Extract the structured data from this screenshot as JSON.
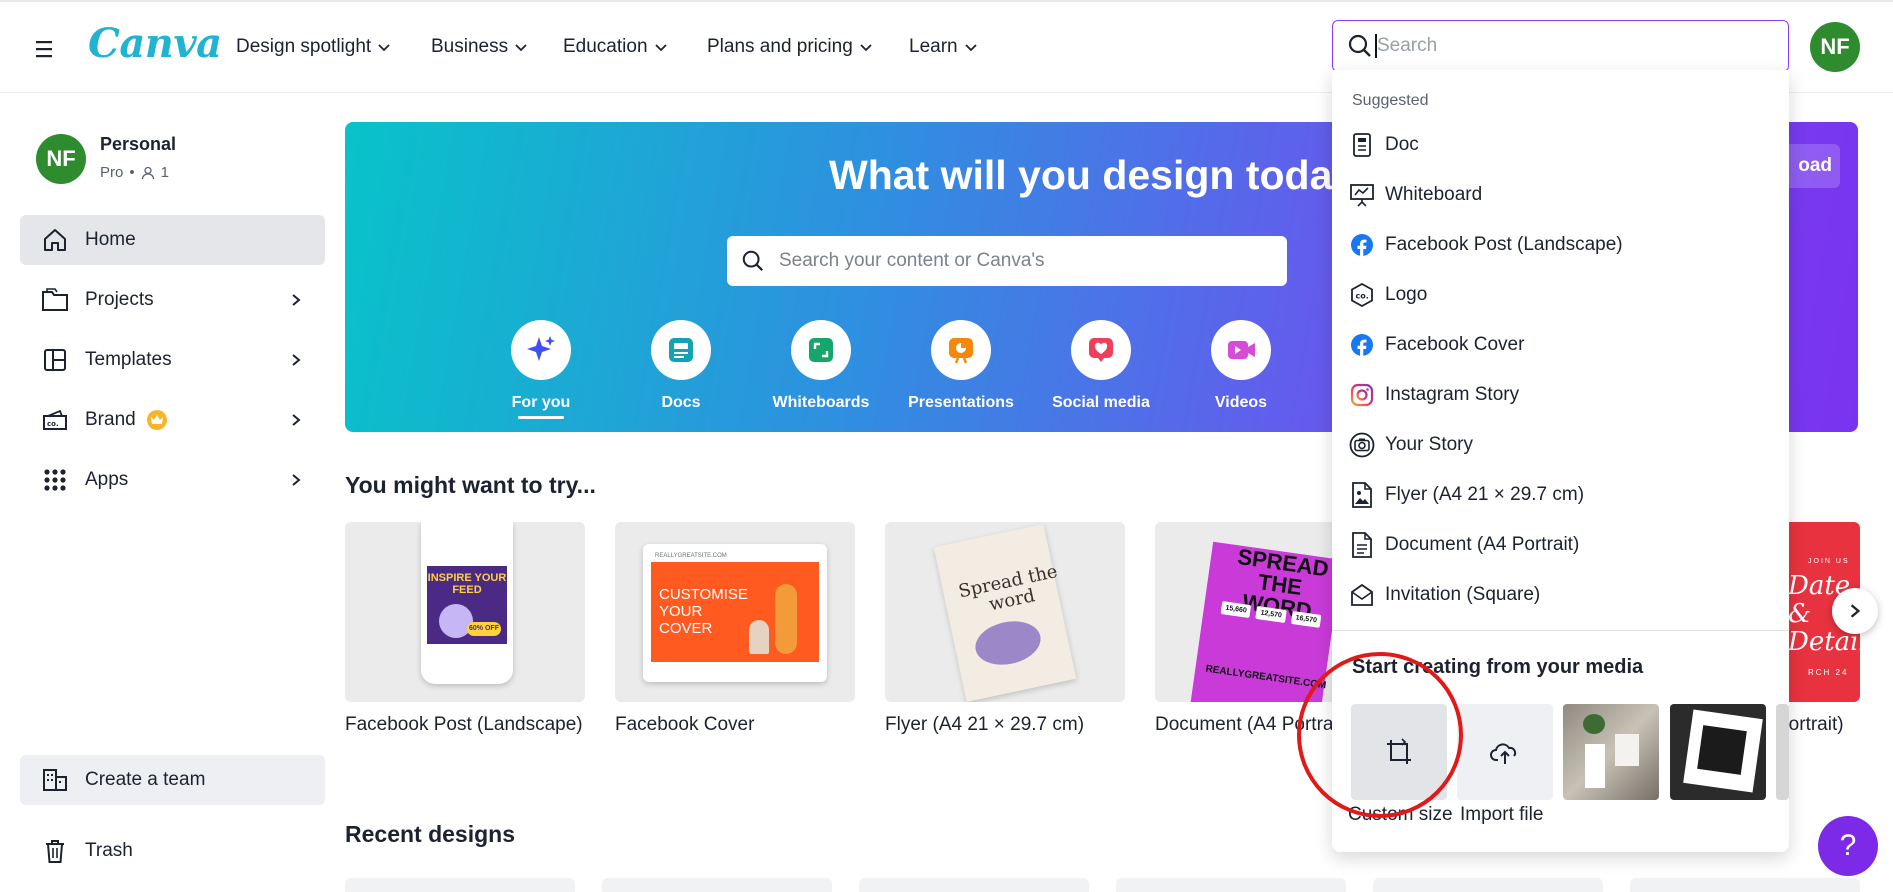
{
  "header": {
    "logo": "Canva",
    "nav": [
      {
        "label": "Design spotlight"
      },
      {
        "label": "Business"
      },
      {
        "label": "Education"
      },
      {
        "label": "Plans and pricing"
      },
      {
        "label": "Learn"
      }
    ],
    "search_placeholder": "Search",
    "avatar_initials": "NF"
  },
  "sidebar": {
    "account_name": "Personal",
    "account_plan": "Pro",
    "account_members": "1",
    "avatar_initials": "NF",
    "items": [
      {
        "label": "Home",
        "icon": "home-icon",
        "active": true
      },
      {
        "label": "Projects",
        "icon": "folder-icon"
      },
      {
        "label": "Templates",
        "icon": "templates-icon"
      },
      {
        "label": "Brand",
        "icon": "brand-icon"
      },
      {
        "label": "Apps",
        "icon": "apps-grid-icon"
      }
    ],
    "create_team": "Create a team",
    "trash": "Trash"
  },
  "hero": {
    "title": "What will you design toda",
    "search_placeholder": "Search your content or Canva's",
    "upload_label": "oad",
    "categories": [
      {
        "label": "For you",
        "icon": "sparkle-icon",
        "color": "#3f4ff2"
      },
      {
        "label": "Docs",
        "icon": "docs-icon",
        "color": "#13a3b5"
      },
      {
        "label": "Whiteboards",
        "icon": "whiteboard-icon",
        "color": "#15a66b"
      },
      {
        "label": "Presentations",
        "icon": "presentation-icon",
        "color": "#f2890b"
      },
      {
        "label": "Social media",
        "icon": "heart-icon",
        "color": "#ef3e5c"
      },
      {
        "label": "Videos",
        "icon": "video-icon",
        "color": "#d84ad8"
      }
    ]
  },
  "try_section": {
    "title": "You might want to try...",
    "cards": [
      {
        "label": "Facebook Post (Landscape)",
        "thumb_text": "INSPIRE YOUR FEED",
        "badge": "60% OFF"
      },
      {
        "label": "Facebook Cover",
        "thumb_text": "CUSTOMISE YOUR COVER",
        "site": "REALLYGREATSITE.COM"
      },
      {
        "label": "Flyer (A4 21 × 29.7 cm)",
        "thumb_text": "Spread the word"
      },
      {
        "label": "Document (A4 Portra",
        "thumb_text": "SPREAD THE WORD",
        "stats": [
          "15,660",
          "12,570",
          "16,570"
        ],
        "site": "REALLYGREATSITE.COM"
      },
      {
        "label": "Portrait)",
        "thumb_text": "Date & Details",
        "partial": "JOIN US",
        "partial2": "RCH 24"
      }
    ]
  },
  "recent_section": {
    "title": "Recent designs"
  },
  "dropdown": {
    "suggested_label": "Suggested",
    "items": [
      {
        "label": "Doc",
        "icon": "doc-icon"
      },
      {
        "label": "Whiteboard",
        "icon": "whiteboard-icon"
      },
      {
        "label": "Facebook Post (Landscape)",
        "icon": "facebook-icon"
      },
      {
        "label": "Logo",
        "icon": "logo-co-icon"
      },
      {
        "label": "Facebook Cover",
        "icon": "facebook-icon"
      },
      {
        "label": "Instagram Story",
        "icon": "instagram-icon"
      },
      {
        "label": "Your Story",
        "icon": "story-camera-icon"
      },
      {
        "label": "Flyer (A4 21 × 29.7 cm)",
        "icon": "flyer-icon"
      },
      {
        "label": "Document (A4 Portrait)",
        "icon": "document-icon"
      },
      {
        "label": "Invitation (Square)",
        "icon": "envelope-icon"
      }
    ],
    "media_title": "Start creating from your media",
    "custom_size": "Custom size",
    "import_file": "Import file"
  },
  "help_label": "?",
  "colors": {
    "accent": "#8b3dff",
    "avatar": "#2e8b2e",
    "annotation": "#e01919",
    "help": "#7d2ae8"
  }
}
